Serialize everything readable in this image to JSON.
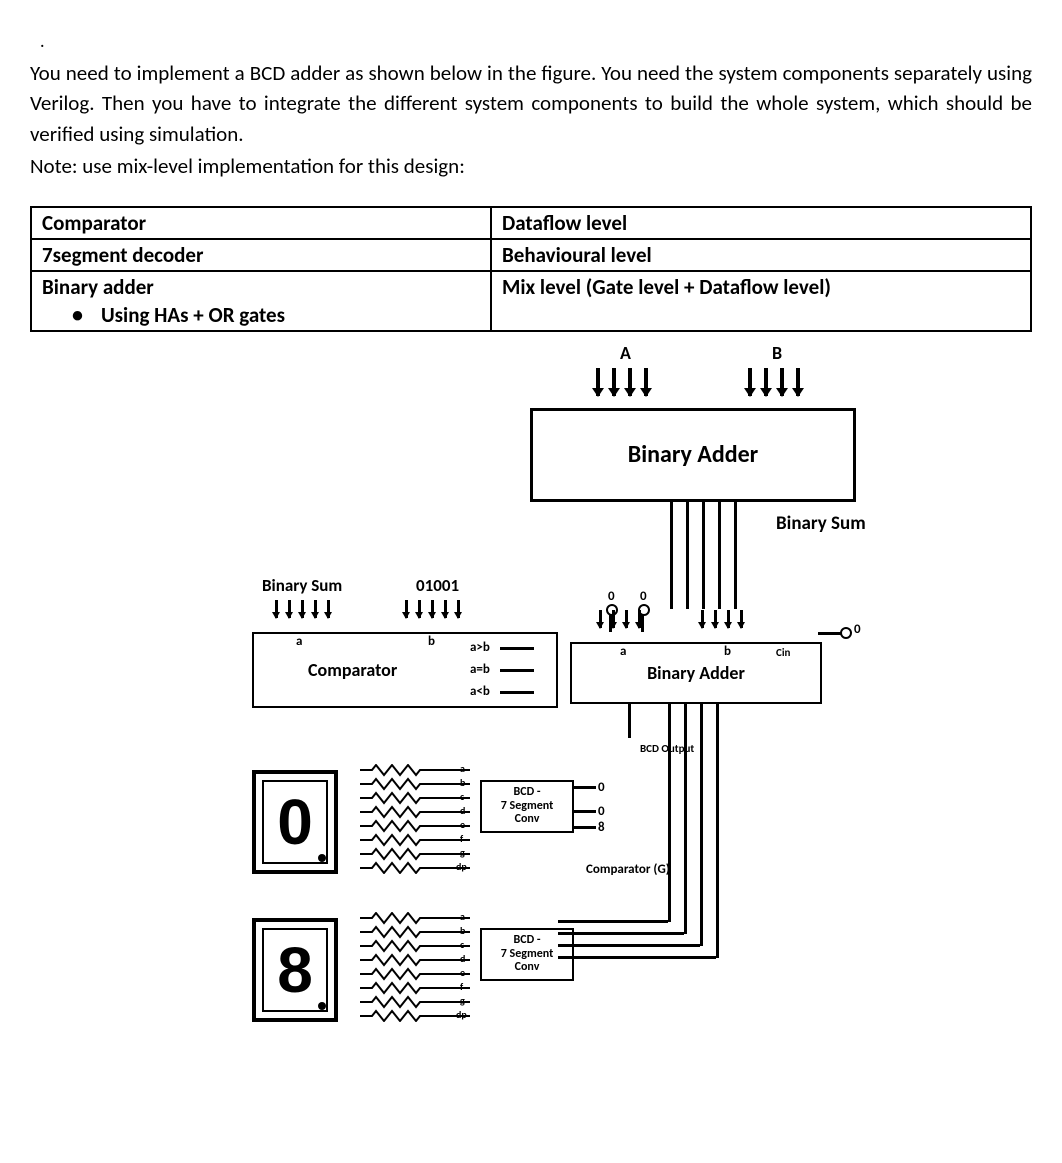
{
  "dot": ".",
  "paragraph": "You need to implement a BCD adder as shown below in the figure. You need the system components separately using Verilog. Then you have to integrate the different system components to build the whole system, which should be verified using simulation.",
  "note": "Note: use mix-level implementation for this design:",
  "table": {
    "rows": [
      {
        "c1": "Comparator",
        "c1_sub": "",
        "c2": "Dataflow level"
      },
      {
        "c1": "7segment decoder",
        "c1_sub": "",
        "c2": "Behavioural level"
      },
      {
        "c1": "Binary adder",
        "c1_sub": "Using HAs + OR gates",
        "c2": "Mix level (Gate level + Dataflow level)"
      }
    ]
  },
  "fig": {
    "inA": "A",
    "inB": "B",
    "ba1": "Binary Adder",
    "bsum_right": "Binary Sum",
    "bsum_left": "Binary Sum",
    "const01001": "01001",
    "comp_a": "a",
    "comp_b": "b",
    "comp_title": "Comparator",
    "comp_gt": "a>b",
    "comp_eq": "a=b",
    "comp_lt": "a<b",
    "ba2_a": "a",
    "ba2_b": "b",
    "ba2_cin": "Cin",
    "ba2_zero1": "0",
    "ba2_zero2": "0",
    "ba2_zeroR": "0",
    "ba2": "Binary Adder",
    "bcd_out": "BCD Output",
    "conv": "BCD -\n7 Segment\nConv",
    "pins": {
      "a": "a",
      "b": "b",
      "c": "c",
      "d": "d",
      "e": "e",
      "f": "f",
      "g": "g",
      "dp": "dp"
    },
    "seg_top": "0",
    "seg_bot": "8",
    "compG": "Comparator (G)",
    "mux0": "0",
    "mux8": "8",
    "muxmid": "0"
  }
}
